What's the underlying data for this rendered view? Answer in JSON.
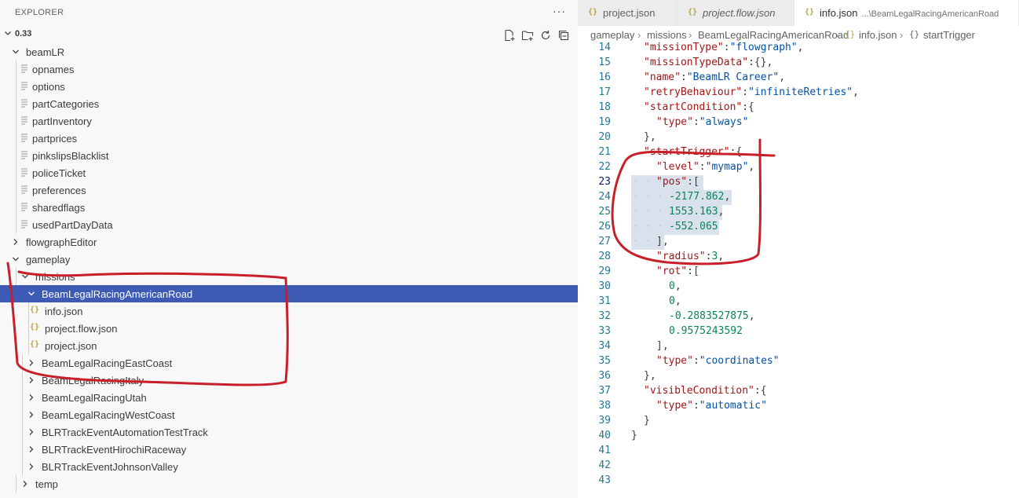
{
  "explorer": {
    "title": "EXPLORER",
    "more": "···",
    "root_label": "0.33",
    "actions": [
      "new-file-icon",
      "new-folder-icon",
      "refresh-icon",
      "collapse-all-icon"
    ],
    "rows": [
      {
        "label": "beamLR",
        "kind": "folder-open",
        "depth": 1
      },
      {
        "label": "opnames",
        "kind": "file",
        "depth": 2
      },
      {
        "label": "options",
        "kind": "file",
        "depth": 2
      },
      {
        "label": "partCategories",
        "kind": "file",
        "depth": 2
      },
      {
        "label": "partInventory",
        "kind": "file",
        "depth": 2
      },
      {
        "label": "partprices",
        "kind": "file",
        "depth": 2
      },
      {
        "label": "pinkslipsBlacklist",
        "kind": "file",
        "depth": 2
      },
      {
        "label": "policeTicket",
        "kind": "file",
        "depth": 2
      },
      {
        "label": "preferences",
        "kind": "file",
        "depth": 2
      },
      {
        "label": "sharedflags",
        "kind": "file",
        "depth": 2
      },
      {
        "label": "usedPartDayData",
        "kind": "file",
        "depth": 2
      },
      {
        "label": "flowgraphEditor",
        "kind": "folder-closed",
        "depth": 1
      },
      {
        "label": "gameplay",
        "kind": "folder-open",
        "depth": 1
      },
      {
        "label": "missions",
        "kind": "folder-open",
        "depth": 2
      },
      {
        "label": "BeamLegalRacingAmericanRoad",
        "kind": "folder-open",
        "depth": 3,
        "selected": true
      },
      {
        "label": "info.json",
        "kind": "json",
        "depth": 4
      },
      {
        "label": "project.flow.json",
        "kind": "json",
        "depth": 4
      },
      {
        "label": "project.json",
        "kind": "json",
        "depth": 4
      },
      {
        "label": "BeamLegalRacingEastCoast",
        "kind": "folder-closed",
        "depth": 3
      },
      {
        "label": "BeamLegalRacingItaly",
        "kind": "folder-closed",
        "depth": 3
      },
      {
        "label": "BeamLegalRacingUtah",
        "kind": "folder-closed",
        "depth": 3
      },
      {
        "label": "BeamLegalRacingWestCoast",
        "kind": "folder-closed",
        "depth": 3
      },
      {
        "label": "BLRTrackEventAutomationTestTrack",
        "kind": "folder-closed",
        "depth": 3
      },
      {
        "label": "BLRTrackEventHirochiRaceway",
        "kind": "folder-closed",
        "depth": 3
      },
      {
        "label": "BLRTrackEventJohnsonValley",
        "kind": "folder-closed",
        "depth": 3
      },
      {
        "label": "temp",
        "kind": "folder-closed",
        "depth": 2
      }
    ]
  },
  "tabs": [
    {
      "icon": "{}",
      "label": "project.json",
      "desc": "",
      "italic": false,
      "active": false
    },
    {
      "icon": "{}",
      "label": "project.flow.json",
      "desc": "",
      "italic": true,
      "active": false
    },
    {
      "icon": "{}",
      "label": "info.json",
      "desc": "...\\BeamLegalRacingAmericanRoad",
      "italic": false,
      "active": true
    }
  ],
  "breadcrumb": {
    "items": [
      "gameplay",
      "missions",
      "BeamLegalRacingAmericanRoad",
      "info.json",
      "startTrigger"
    ],
    "icons": [
      "",
      "",
      "",
      "{}",
      "{}"
    ],
    "separator": "›"
  },
  "editor": {
    "current_line": 23,
    "lines": [
      {
        "n": "14",
        "indent": 1,
        "tokens": [
          [
            "k",
            "\"missionType\""
          ],
          [
            "p",
            ":"
          ],
          [
            "s",
            "\"flowgraph\""
          ],
          [
            "p",
            ","
          ]
        ]
      },
      {
        "n": "15",
        "indent": 1,
        "tokens": [
          [
            "k",
            "\"missionTypeData\""
          ],
          [
            "p",
            ":{},"
          ]
        ]
      },
      {
        "n": "16",
        "indent": 1,
        "tokens": [
          [
            "k",
            "\"name\""
          ],
          [
            "p",
            ":"
          ],
          [
            "s",
            "\"BeamLR Career\""
          ],
          [
            "p",
            ","
          ]
        ]
      },
      {
        "n": "17",
        "indent": 1,
        "tokens": [
          [
            "k",
            "\"retryBehaviour\""
          ],
          [
            "p",
            ":"
          ],
          [
            "s",
            "\"infiniteRetries\""
          ],
          [
            "p",
            ","
          ]
        ]
      },
      {
        "n": "18",
        "indent": 1,
        "tokens": [
          [
            "k",
            "\"startCondition\""
          ],
          [
            "p",
            ":{"
          ]
        ]
      },
      {
        "n": "19",
        "indent": 2,
        "tokens": [
          [
            "k",
            "\"type\""
          ],
          [
            "p",
            ":"
          ],
          [
            "s",
            "\"always\""
          ]
        ]
      },
      {
        "n": "20",
        "indent": 1,
        "tokens": [
          [
            "p",
            "},"
          ]
        ]
      },
      {
        "n": "21",
        "indent": 1,
        "tokens": [
          [
            "k",
            "\"startTrigger\""
          ],
          [
            "p",
            ":{"
          ]
        ]
      },
      {
        "n": "22",
        "indent": 2,
        "tokens": [
          [
            "k",
            "\"level\""
          ],
          [
            "p",
            ":"
          ],
          [
            "s",
            "\"mymap\""
          ],
          [
            "p",
            ","
          ]
        ]
      },
      {
        "n": "23",
        "indent": 2,
        "tokens": [
          [
            "k",
            "\"pos\""
          ],
          [
            "p",
            ":["
          ]
        ]
      },
      {
        "n": "24",
        "indent": 3,
        "tokens": [
          [
            "n",
            "-2177.862"
          ],
          [
            "p",
            ","
          ]
        ]
      },
      {
        "n": "25",
        "indent": 3,
        "tokens": [
          [
            "n",
            "1553.163"
          ],
          [
            "p",
            ","
          ]
        ]
      },
      {
        "n": "26",
        "indent": 3,
        "tokens": [
          [
            "n",
            "-552.065"
          ]
        ]
      },
      {
        "n": "27",
        "indent": 2,
        "tokens": [
          [
            "p",
            "],"
          ]
        ]
      },
      {
        "n": "28",
        "indent": 2,
        "tokens": [
          [
            "k",
            "\"radius\""
          ],
          [
            "p",
            ":"
          ],
          [
            "n",
            "3"
          ],
          [
            "p",
            ","
          ]
        ]
      },
      {
        "n": "29",
        "indent": 2,
        "tokens": [
          [
            "k",
            "\"rot\""
          ],
          [
            "p",
            ":["
          ]
        ]
      },
      {
        "n": "30",
        "indent": 3,
        "tokens": [
          [
            "n",
            "0"
          ],
          [
            "p",
            ","
          ]
        ]
      },
      {
        "n": "31",
        "indent": 3,
        "tokens": [
          [
            "n",
            "0"
          ],
          [
            "p",
            ","
          ]
        ]
      },
      {
        "n": "32",
        "indent": 3,
        "tokens": [
          [
            "n",
            "-0.2883527875"
          ],
          [
            "p",
            ","
          ]
        ]
      },
      {
        "n": "33",
        "indent": 3,
        "tokens": [
          [
            "n",
            "0.9575243592"
          ]
        ]
      },
      {
        "n": "34",
        "indent": 2,
        "tokens": [
          [
            "p",
            "],"
          ]
        ]
      },
      {
        "n": "35",
        "indent": 2,
        "tokens": [
          [
            "k",
            "\"type\""
          ],
          [
            "p",
            ":"
          ],
          [
            "s",
            "\"coordinates\""
          ]
        ]
      },
      {
        "n": "36",
        "indent": 1,
        "tokens": [
          [
            "p",
            "},"
          ]
        ]
      },
      {
        "n": "37",
        "indent": 1,
        "tokens": [
          [
            "k",
            "\"visibleCondition\""
          ],
          [
            "p",
            ":{"
          ]
        ]
      },
      {
        "n": "38",
        "indent": 2,
        "tokens": [
          [
            "k",
            "\"type\""
          ],
          [
            "p",
            ":"
          ],
          [
            "s",
            "\"automatic\""
          ]
        ]
      },
      {
        "n": "39",
        "indent": 1,
        "tokens": [
          [
            "p",
            "}"
          ]
        ]
      },
      {
        "n": "40",
        "indent": 0,
        "tokens": [
          [
            "p",
            "}"
          ]
        ]
      },
      {
        "n": "41",
        "indent": 0,
        "tokens": []
      },
      {
        "n": "42",
        "indent": 0,
        "tokens": []
      },
      {
        "n": "43",
        "indent": 0,
        "tokens": []
      }
    ]
  },
  "colors": {
    "selection_row": "#3d5ab5",
    "annotation_red": "#c8202a"
  }
}
